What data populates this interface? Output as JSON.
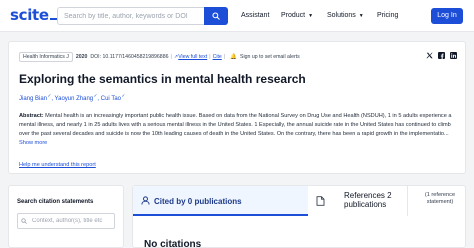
{
  "header": {
    "logo": "scite",
    "search_placeholder": "Search by title, author, keywords or DOI",
    "nav": [
      {
        "label": "Assistant",
        "dropdown": false
      },
      {
        "label": "Product",
        "dropdown": true
      },
      {
        "label": "Solutions",
        "dropdown": true
      },
      {
        "label": "Pricing",
        "dropdown": false
      }
    ],
    "login_label": "Log In"
  },
  "paper": {
    "journal": "Health Informatics J",
    "year": "2020",
    "doi": "DOI: 10.1177/1460458219896886",
    "view_full_text": "View full text",
    "cite": "Cite",
    "alert": "Sign up to set email alerts",
    "share_icons": [
      "twitter-icon",
      "facebook-icon",
      "linkedin-icon"
    ],
    "title": "Exploring the semantics in mental health research",
    "authors": [
      "Jiang Bian",
      "Yaoyun Zhang",
      "Cui Tao"
    ],
    "abstract_label": "Abstract:",
    "abstract_text": "Mental health is an increasingly important public health issue. Based on data from the National Survey on Drug Use and Health (NSDUH), 1 in 5 adults experience a mental illness, and nearly 1 in 25 adults lives with a serious mental illness in the United States. 1 Especially, the annual suicide rate in the United States has continued to climb over the past several decades and suicide is now the 10th leading causes of death in the United States. On the contrary, there has been a rapid growth in the implementatio...",
    "show_more": "Show more",
    "help_link": "Help me understand this report"
  },
  "citation_search": {
    "title": "Search citation statements",
    "placeholder": "Context, author(s), title etc"
  },
  "tabs": {
    "cited_by": "Cited by 0 publications",
    "references_line1": "References 2",
    "references_line2": "publications",
    "statement_line1": "(1 reference",
    "statement_line2": "statement)"
  },
  "empty_state": "No citations",
  "colors": {
    "brand": "#1d4ed8",
    "background": "#f3f4f6"
  }
}
